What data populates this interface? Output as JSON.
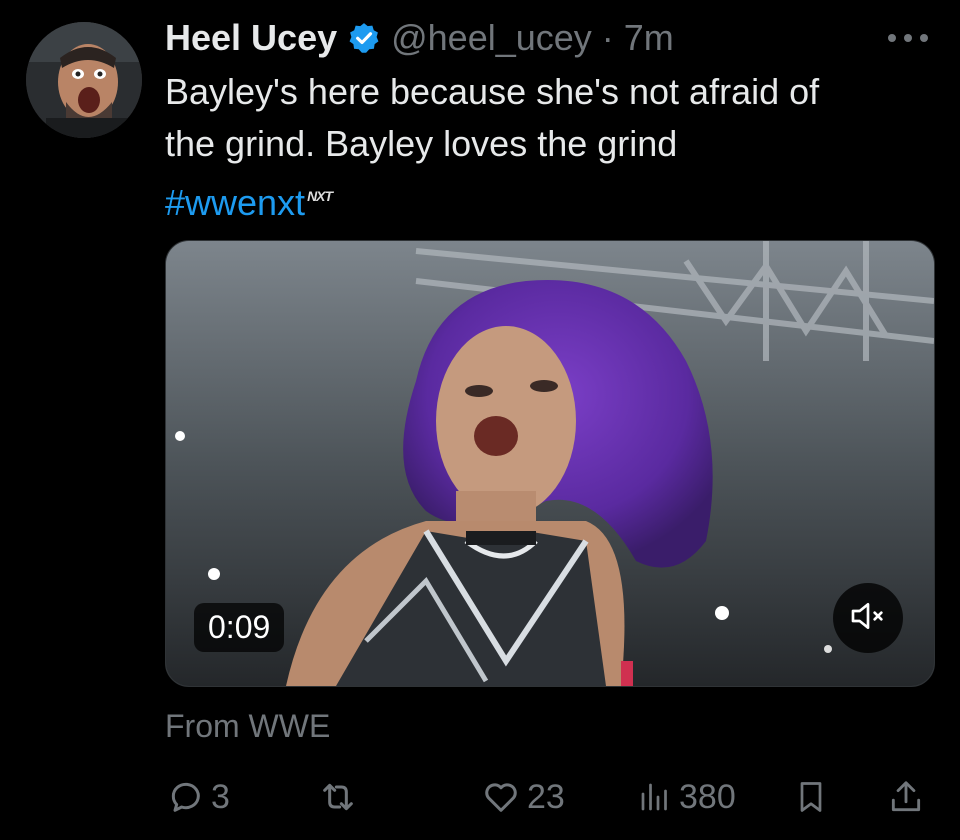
{
  "tweet": {
    "author": {
      "display_name": "Heel Ucey",
      "handle": "@heel_ucey",
      "separator": "·",
      "time": "7m",
      "verified": true
    },
    "text_line1": "Bayley's here because she's not afraid of",
    "text_line2": "the grind. Bayley loves the grind",
    "hashtag": "#wwenxt",
    "hashtag_emoji": "NXT",
    "media": {
      "duration": "0:09",
      "muted": true
    },
    "source": "From WWE",
    "stats": {
      "replies": "3",
      "reposts": "",
      "likes": "23",
      "views": "380"
    }
  },
  "colors": {
    "background": "#000000",
    "text": "#e7e9ea",
    "secondary": "#71767b",
    "accent": "#1d9bf0"
  },
  "icons": [
    "more-icon",
    "verified-icon",
    "reply-icon",
    "repost-icon",
    "like-icon",
    "views-icon",
    "bookmark-icon",
    "share-icon",
    "mute-icon"
  ]
}
